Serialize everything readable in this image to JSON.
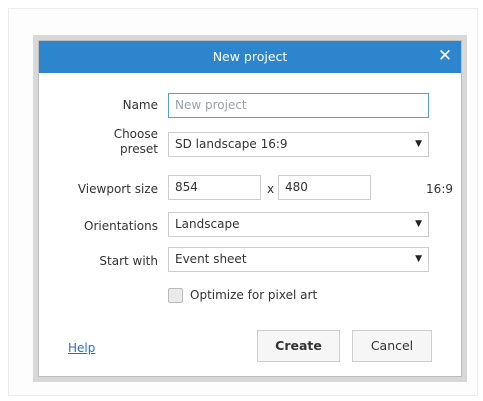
{
  "dialog": {
    "title": "New project",
    "close_glyph": "✕"
  },
  "form": {
    "name_label": "Name",
    "name_placeholder": "New project",
    "preset_label": "Choose preset",
    "preset_value": "SD landscape 16:9",
    "viewport_label": "Viewport size",
    "viewport_width": "854",
    "viewport_sep": "x",
    "viewport_height": "480",
    "viewport_ratio": "16:9",
    "orientations_label": "Orientations",
    "orientations_value": "Landscape",
    "start_with_label": "Start with",
    "start_with_value": "Event sheet",
    "pixel_art_label": "Optimize for pixel art",
    "dropdown_glyph": "▼"
  },
  "footer": {
    "help": "Help",
    "create": "Create",
    "cancel": "Cancel"
  },
  "colors": {
    "titlebar": "#2d85ce",
    "link": "#2b6fc1",
    "focus_border": "#5b9bd5"
  }
}
